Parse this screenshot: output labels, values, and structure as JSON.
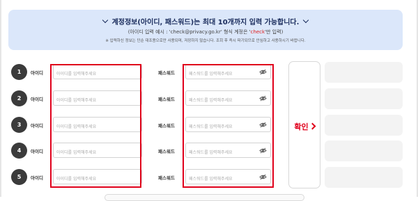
{
  "notice": {
    "title": "계정정보(아이디, 패스워드)는 최대 10개까지 입력 가능합니다.",
    "example_prefix": "(아이디 입력 예시 : 'check@privacy.go.kr' 형식 계정은 '",
    "example_highlight": "check",
    "example_suffix": "'만 입력)",
    "note": "※ 입력하신 정보는 단순 대조용으로만 사용되며, 저장하지 않습니다. 조회 후 즉시 파기되므로 안심하고 사용하시기 바랍니다."
  },
  "rows": [
    {
      "number": "1",
      "id_label": "아이디",
      "id_placeholder": "아이디를 입력해주세요",
      "pw_label": "패스워드",
      "pw_placeholder": "패스워드를 입력해주세요"
    },
    {
      "number": "2",
      "id_label": "아이디",
      "id_placeholder": "아이디를 입력해주세요",
      "pw_label": "패스워드",
      "pw_placeholder": "패스워드를 입력해주세요"
    },
    {
      "number": "3",
      "id_label": "아이디",
      "id_placeholder": "아이디를 입력해주세요",
      "pw_label": "패스워드",
      "pw_placeholder": "패스워드를 입력해주세요"
    },
    {
      "number": "4",
      "id_label": "아이디",
      "id_placeholder": "아이디를 입력해주세요",
      "pw_label": "패스워드",
      "pw_placeholder": "패스워드를 입력해주세요"
    },
    {
      "number": "5",
      "id_label": "아이디",
      "id_placeholder": "아이디를 입력해주세요",
      "pw_label": "패스워드",
      "pw_placeholder": "패스워드를 입력해주세요"
    }
  ],
  "confirm": {
    "label": "확인"
  },
  "icons": {
    "notice_chevron": "chevron-down-icon",
    "password_toggle": "eye-off-icon",
    "confirm_arrow": "chevron-right-icon"
  },
  "colors": {
    "accent_red": "#e0001b",
    "notice_bg": "#dbe7fa",
    "number_badge": "#3b3b3b"
  }
}
